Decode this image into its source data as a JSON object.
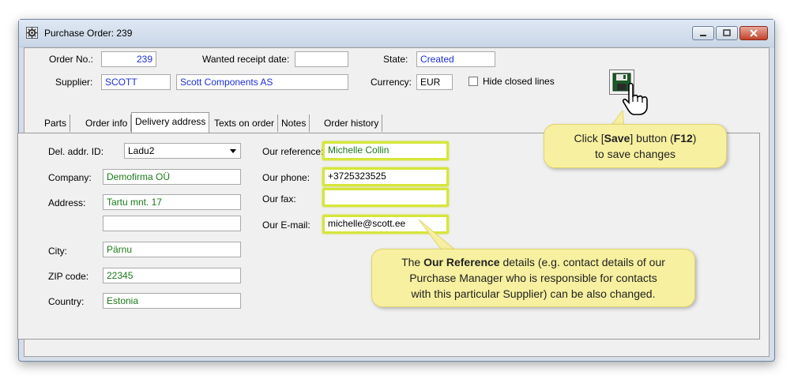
{
  "window": {
    "title": "Purchase Order: 239"
  },
  "header": {
    "order_no_label": "Order No.:",
    "order_no_value": "239",
    "wanted_receipt_label": "Wanted receipt date:",
    "wanted_receipt_value": "",
    "state_label": "State:",
    "state_value": "Created",
    "supplier_label": "Supplier:",
    "supplier_code": "SCOTT",
    "supplier_name": "Scott Components AS",
    "currency_label": "Currency:",
    "currency_value": "EUR",
    "hide_closed_label": "Hide closed lines"
  },
  "tabs": [
    {
      "label": "Parts"
    },
    {
      "label": "Order info"
    },
    {
      "label": "Delivery address"
    },
    {
      "label": "Texts on order"
    },
    {
      "label": "Notes"
    },
    {
      "label": "Order history"
    }
  ],
  "active_tab": "Delivery address",
  "delivery": {
    "del_addr_id_label": "Del. addr. ID:",
    "del_addr_id_value": "Ladu2",
    "company_label": "Company:",
    "company_value": "Demofirma OÜ",
    "address_label": "Address:",
    "address_line1": "Tartu mnt. 17",
    "address_line2": "",
    "city_label": "City:",
    "city_value": "Pärnu",
    "zip_label": "ZIP code:",
    "zip_value": "22345",
    "country_label": "Country:",
    "country_value": "Estonia"
  },
  "our": {
    "reference_label": "Our reference:",
    "reference_value": "Michelle Collin",
    "phone_label": "Our phone:",
    "phone_value": "+3725323525",
    "fax_label": "Our fax:",
    "fax_value": "",
    "email_label": "Our E-mail:",
    "email_value": "michelle@scott.ee"
  },
  "callouts": {
    "save_line1_pre": "Click [",
    "save_line1_bold": "Save",
    "save_line1_mid": "] button (",
    "save_line1_key": "F12",
    "save_line1_post": ")",
    "save_line2": "to save changes",
    "ref_pre": "The ",
    "ref_bold": "Our Reference",
    "ref_line1_post": " details (e.g. contact details of our",
    "ref_line2": "Purchase Manager who is responsible for contacts",
    "ref_line3": "with this particular Supplier) can be also changed."
  },
  "icons": {
    "app": "gear-icon",
    "save": "floppy-disk-icon",
    "cursor": "hand-pointer-icon"
  },
  "colors": {
    "highlight": "#d6e63a",
    "callout_bg": "#f7f0a0",
    "value_blue": "#1b2fd6",
    "value_green": "#1a7a1a"
  }
}
